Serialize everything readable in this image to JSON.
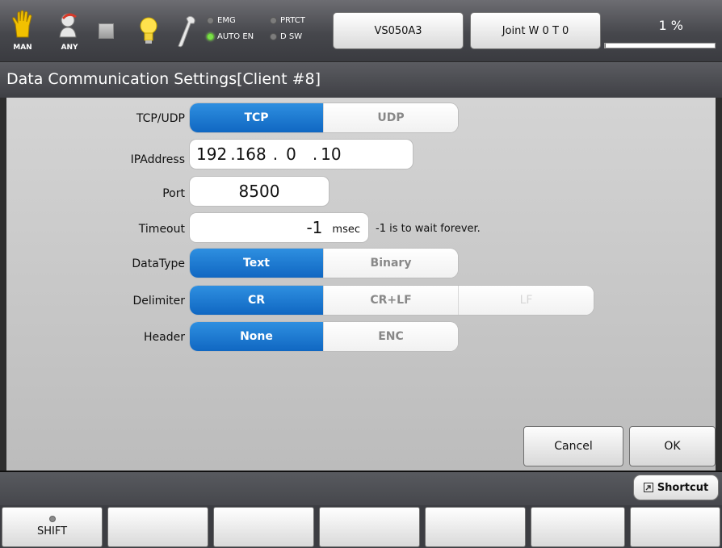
{
  "status": {
    "mode_icon": "hand-icon",
    "mode_label": "MAN",
    "user_icon": "user-icon",
    "user_label": "ANY",
    "lamps": {
      "emg": "EMG",
      "prtct": "PRTCT",
      "auto_en": "AUTO EN",
      "dsw": "D SW"
    },
    "robot_model": "VS050A3",
    "coord_mode": "Joint W 0 T 0",
    "speed": "1 %",
    "speed_fraction": 0.01,
    "lamp_on_color": "#7be04a"
  },
  "title": "Data Communication Settings[Client #8]",
  "form": {
    "tcpudp_label": "TCP/UDP",
    "tcpudp_options": [
      "TCP",
      "UDP"
    ],
    "tcpudp_selected": "TCP",
    "ip_label": "IPAddress",
    "ip_octets": [
      "192",
      ".168",
      ".",
      "0",
      ".",
      "10"
    ],
    "port_label": "Port",
    "port_value": "8500",
    "timeout_label": "Timeout",
    "timeout_value": "-1",
    "timeout_unit": "msec",
    "timeout_note": "-1 is to wait forever.",
    "datatype_label": "DataType",
    "datatype_options": [
      "Text",
      "Binary"
    ],
    "datatype_selected": "Text",
    "delimiter_label": "Delimiter",
    "delimiter_options": [
      "CR",
      "CR+LF",
      "LF"
    ],
    "delimiter_selected": "CR",
    "delimiter_disabled": "LF",
    "header_label": "Header",
    "header_options": [
      "None",
      "ENC"
    ],
    "header_selected": "None"
  },
  "buttons": {
    "cancel": "Cancel",
    "ok": "OK",
    "shortcut": "Shortcut",
    "shift": "SHIFT"
  },
  "colors": {
    "selected_blue": "#1a78d4"
  }
}
